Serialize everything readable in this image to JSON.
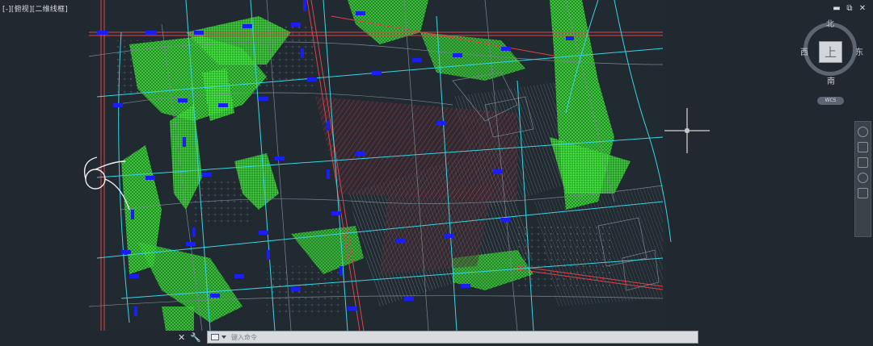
{
  "viewport": {
    "label": "[-][俯视][二维线框]"
  },
  "window_controls": {
    "minimize": "▬",
    "restore": "⧉",
    "close": "✕"
  },
  "viewcube": {
    "face": "上",
    "north": "北",
    "south": "南",
    "east": "东",
    "west": "西",
    "wcs": "WCS"
  },
  "navbar": {
    "items": [
      "full-navigation-wheel-icon",
      "pan-icon",
      "zoom-icon",
      "orbit-icon",
      "showmotion-icon"
    ]
  },
  "command_line": {
    "close": "✕",
    "settings": "🔧",
    "placeholder": "键入命令"
  },
  "colors": {
    "background": "#212830",
    "green_hatch": "#39d42c",
    "red_roads": "#e0414b",
    "cyan_roads": "#35d6e6",
    "blue_markers": "#1a1ef0",
    "gray_lines": "#7b8591"
  }
}
